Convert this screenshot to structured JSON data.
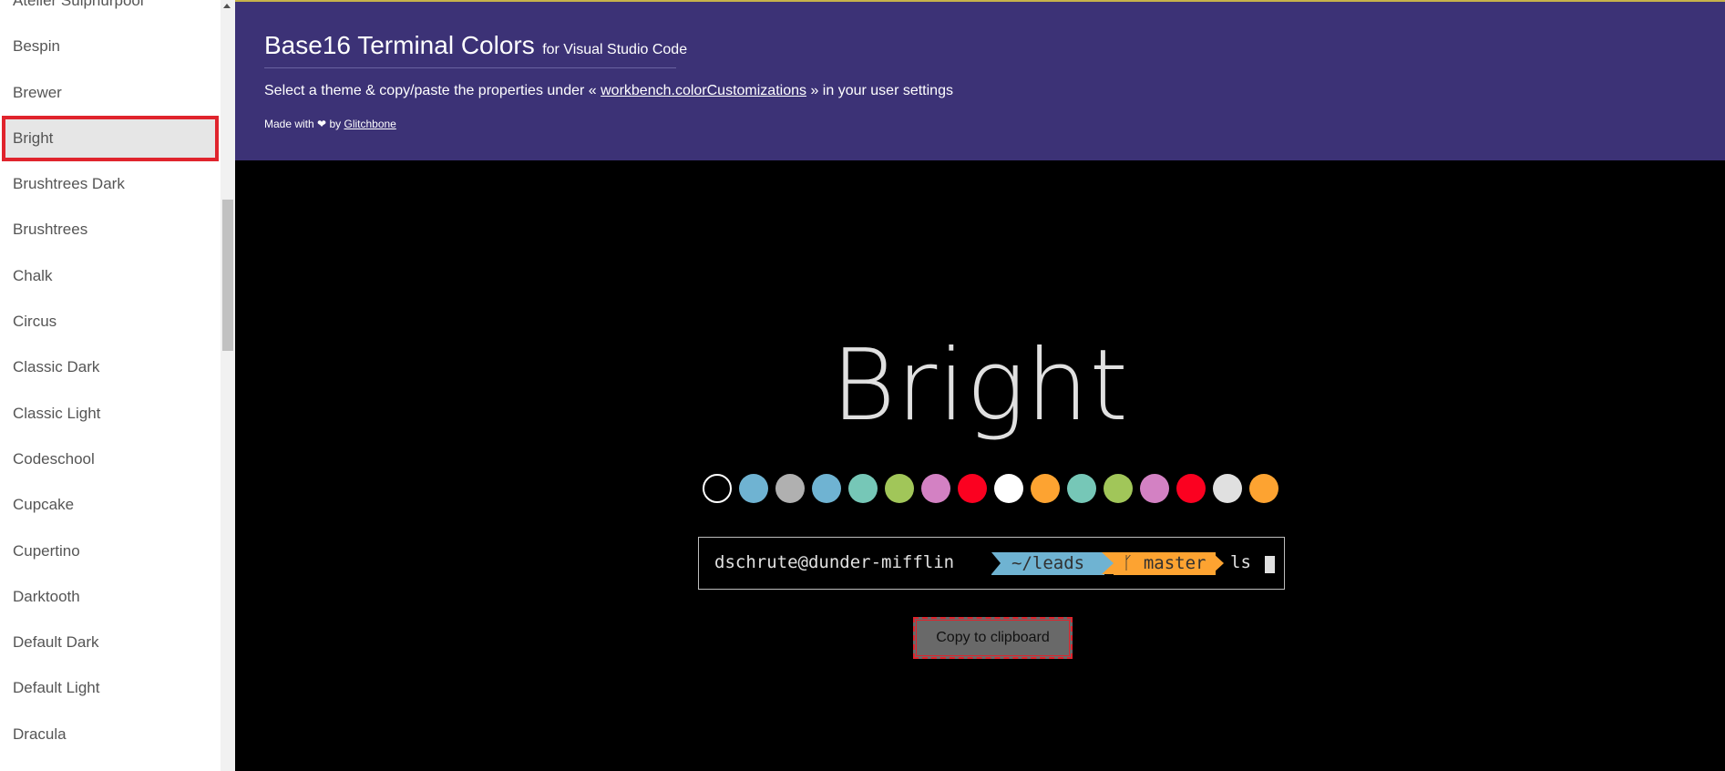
{
  "sidebar": {
    "items": [
      {
        "label": "Atelier Sulphurpool",
        "selected": false
      },
      {
        "label": "Bespin",
        "selected": false
      },
      {
        "label": "Brewer",
        "selected": false
      },
      {
        "label": "Bright",
        "selected": true
      },
      {
        "label": "Brushtrees Dark",
        "selected": false
      },
      {
        "label": "Brushtrees",
        "selected": false
      },
      {
        "label": "Chalk",
        "selected": false
      },
      {
        "label": "Circus",
        "selected": false
      },
      {
        "label": "Classic Dark",
        "selected": false
      },
      {
        "label": "Classic Light",
        "selected": false
      },
      {
        "label": "Codeschool",
        "selected": false
      },
      {
        "label": "Cupcake",
        "selected": false
      },
      {
        "label": "Cupertino",
        "selected": false
      },
      {
        "label": "Darktooth",
        "selected": false
      },
      {
        "label": "Default Dark",
        "selected": false
      },
      {
        "label": "Default Light",
        "selected": false
      },
      {
        "label": "Dracula",
        "selected": false
      }
    ]
  },
  "header": {
    "title": "Base16 Terminal Colors",
    "subtitle": "for Visual Studio Code",
    "instructions_prefix": "Select a theme & copy/paste the properties under «",
    "instructions_link": "workbench.colorCustomizations",
    "instructions_suffix": "» in your user settings",
    "credit_prefix": "Made with",
    "credit_by": "by",
    "credit_link": "Glitchbone",
    "heart_icon": "❤"
  },
  "main": {
    "theme_name": "Bright",
    "swatches": [
      "#000000",
      "#6fb3d2",
      "#b0b0b0",
      "#6fb3d2",
      "#76c7b7",
      "#a1c659",
      "#d381c3",
      "#fb0120",
      "#ffffff",
      "#fda331",
      "#76c7b7",
      "#a1c659",
      "#d381c3",
      "#fb0120",
      "#e0e0e0",
      "#fda331"
    ],
    "terminal": {
      "user_host": "dschrute@dunder-mifflin",
      "directory": "~/leads",
      "branch_icon": "ᚴ",
      "branch": "master",
      "command": "ls"
    },
    "copy_button_label": "Copy to clipboard"
  },
  "colors": {
    "header_bg": "#3c3276",
    "header_top_border": "#c7b34b",
    "selection_outline": "#e0242d",
    "dir_segment": "#6fb3d2",
    "branch_segment": "#fda331"
  }
}
